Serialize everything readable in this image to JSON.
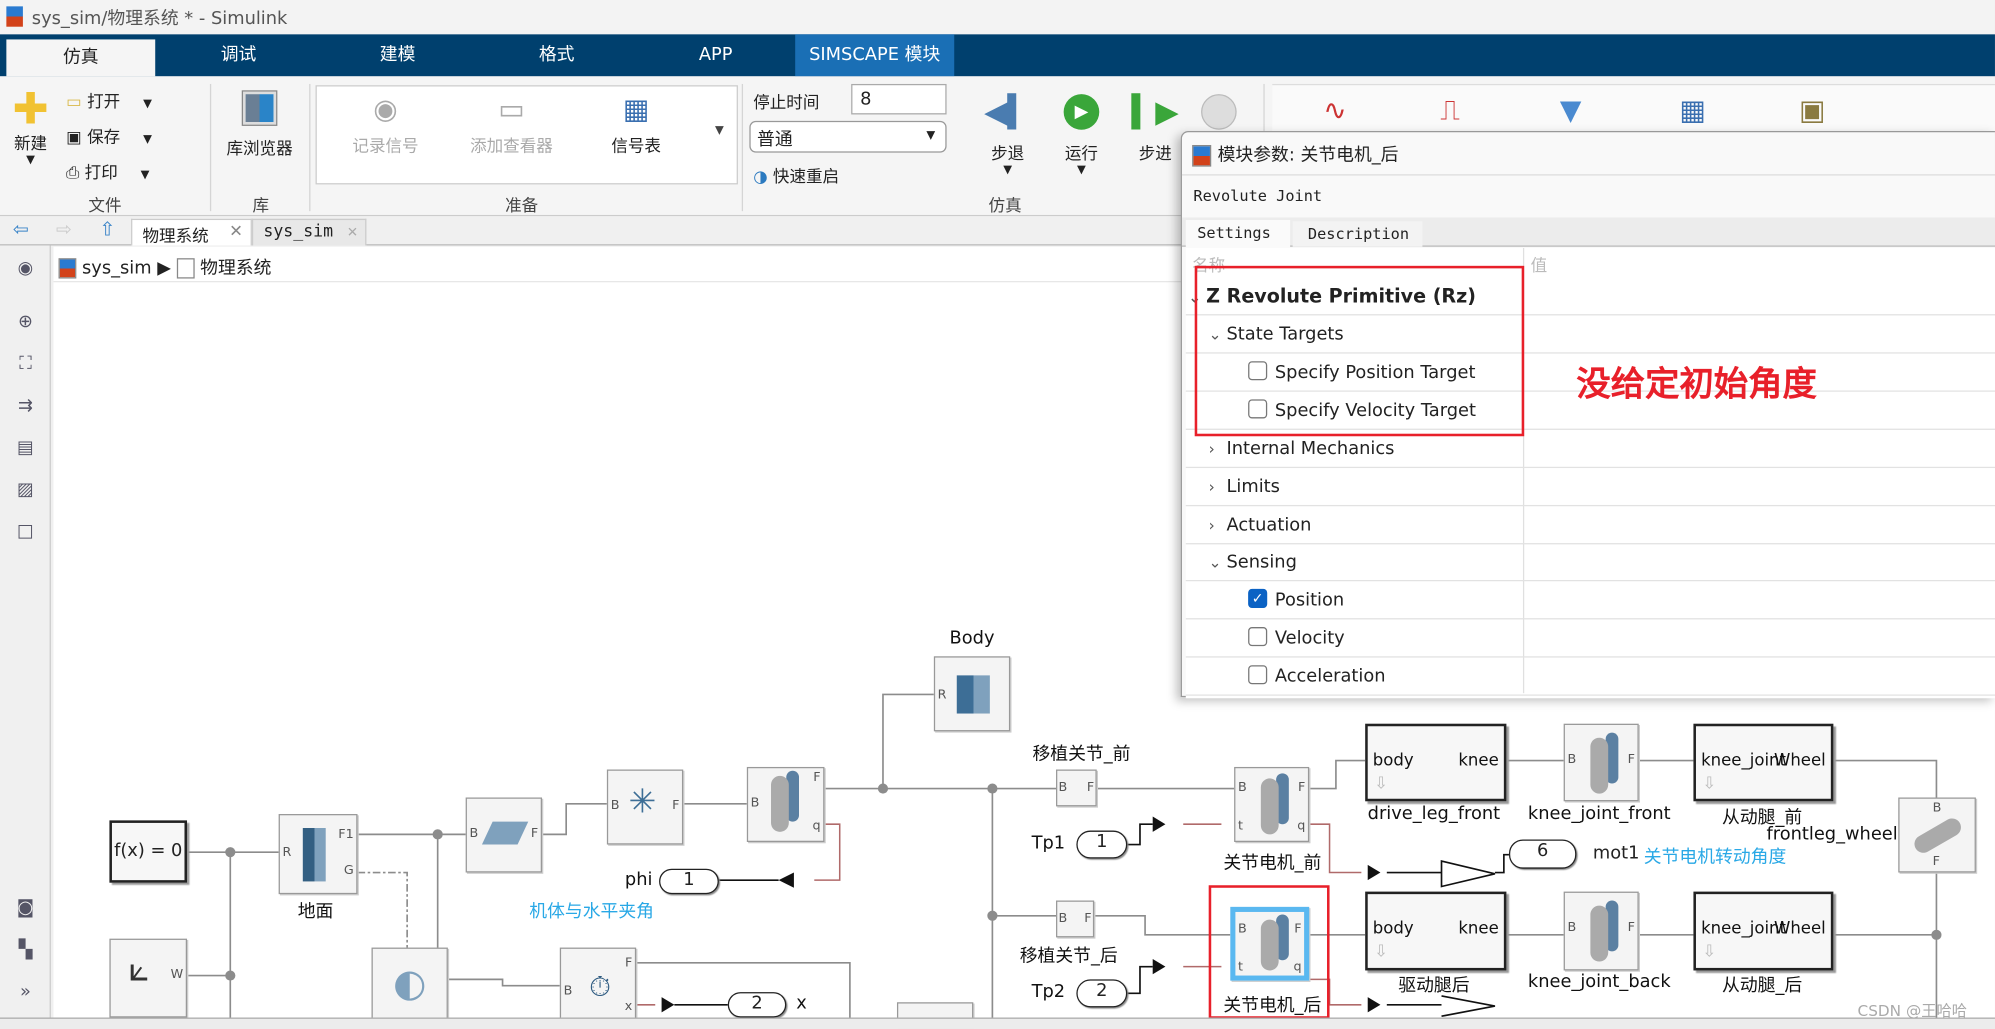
{
  "window": {
    "title": "sys_sim/物理系统 * - Simulink"
  },
  "ribbon_tabs": [
    {
      "label": "仿真",
      "active": true
    },
    {
      "label": "调试"
    },
    {
      "label": "建模"
    },
    {
      "label": "格式"
    },
    {
      "label": "APP"
    },
    {
      "label": "SIMSCAPE 模块"
    }
  ],
  "ribbon": {
    "file": {
      "new": "新建",
      "open": "打开",
      "save": "保存",
      "print": "打印",
      "group": "文件"
    },
    "library": {
      "browser": "库浏览器",
      "group": "库"
    },
    "prepare": {
      "log_signals": "记录信号",
      "add_viewer": "添加查看器",
      "signal_table": "信号表",
      "group": "准备"
    },
    "simulate": {
      "stop_time_label": "停止时间",
      "stop_time_value": "8",
      "mode": "普通",
      "fast_restart": "快速重启",
      "step_back": "步退",
      "run": "运行",
      "step_forward": "步进",
      "group": "仿真"
    }
  },
  "doc_tabs": [
    {
      "label": "物理系统",
      "active": true
    },
    {
      "label": "sys_sim"
    }
  ],
  "breadcrumb": [
    "sys_sim",
    "物理系统"
  ],
  "dialog": {
    "title": "模块参数: 关节电机_后",
    "block_type": "Revolute Joint",
    "tabs": [
      "Settings",
      "Description"
    ],
    "col_name": "名称",
    "col_value": "值",
    "rows": [
      {
        "label": "Z Revolute Primitive (Rz)",
        "kind": "section",
        "expanded": true
      },
      {
        "label": "State Targets",
        "kind": "group",
        "expanded": true
      },
      {
        "label": "Specify Position Target",
        "kind": "checkbox",
        "checked": false
      },
      {
        "label": "Specify Velocity Target",
        "kind": "checkbox",
        "checked": false
      },
      {
        "label": "Internal Mechanics",
        "kind": "group",
        "expanded": false
      },
      {
        "label": "Limits",
        "kind": "group",
        "expanded": false
      },
      {
        "label": "Actuation",
        "kind": "group",
        "expanded": false
      },
      {
        "label": "Sensing",
        "kind": "group",
        "expanded": true
      },
      {
        "label": "Position",
        "kind": "checkbox",
        "checked": true
      },
      {
        "label": "Velocity",
        "kind": "checkbox",
        "checked": false
      },
      {
        "label": "Acceleration",
        "kind": "checkbox",
        "checked": false
      }
    ],
    "annotation": "没给定初始角度",
    "annotation_color": "#e8202a"
  },
  "diagram": {
    "solver": "f(x) = 0",
    "ground": "地面",
    "body": "Body",
    "phi_port": "1",
    "phi_label": "phi",
    "phi_note": "机体与水平夹角",
    "x_port": "2",
    "x_label": "x",
    "weld_front": "移植关节_前",
    "weld_back": "移植关节_后",
    "motor_front": "关节电机_前",
    "motor_back": "关节电机_后",
    "tp1_label": "Tp1",
    "tp1_port": "1",
    "tp2_label": "Tp2",
    "tp2_port": "2",
    "drive_leg_front": "drive_leg_front",
    "drive_leg_back": "驱动腿后",
    "knee_front": "knee_joint_front",
    "knee_back": "knee_joint_back",
    "follow_front": "从动腿_前",
    "follow_back": "从动腿_后",
    "wheel": "frontleg_wheel",
    "mot_port": "6",
    "mot_label": "mot1",
    "mot_note": "关节电机转动角度",
    "sub_in": "body",
    "sub_out": "knee",
    "sub2_in": "knee_joint",
    "sub2_out": "Wheel"
  },
  "watermark": "CSDN @王哈哈"
}
